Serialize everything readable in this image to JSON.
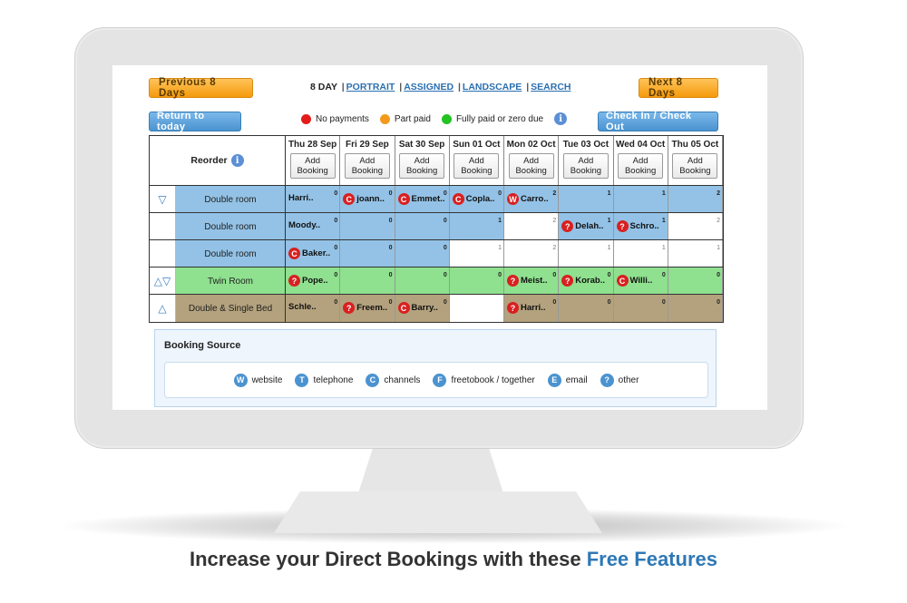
{
  "toolbar": {
    "prev_label": "Previous 8 Days",
    "next_label": "Next 8 Days",
    "return_label": "Return to today",
    "checkin_label": "Check In / Check Out",
    "view_current": "8 DAY",
    "views": [
      "PORTRAIT",
      "ASSIGNED",
      "LANDSCAPE",
      "SEARCH"
    ]
  },
  "legend": {
    "items": [
      {
        "label": "No payments",
        "color": "#e41b1b"
      },
      {
        "label": "Part paid",
        "color": "#f39a1c"
      },
      {
        "label": "Fully paid or zero due",
        "color": "#22c322"
      }
    ]
  },
  "grid": {
    "reorder_label": "Reorder",
    "add_booking_line1": "Add",
    "add_booking_line2": "Booking",
    "days": [
      "Thu 28 Sep",
      "Fri 29 Sep",
      "Sat 30 Sep",
      "Sun 01 Oct",
      "Mon 02 Oct",
      "Tue 03 Oct",
      "Wed 04 Oct",
      "Thu 05 Oct"
    ],
    "rows": [
      {
        "arrows": "▽",
        "name": "Double room",
        "bg": "#93c2e6",
        "cells": [
          {
            "guest": "Harri..",
            "src": "",
            "count": "0",
            "fill": "blue"
          },
          {
            "guest": "joann..",
            "src": "C",
            "count": "0",
            "fill": "blue"
          },
          {
            "guest": "Emmet..",
            "src": "C",
            "count": "0",
            "fill": "blue"
          },
          {
            "guest": "Copla..",
            "src": "C",
            "count": "0",
            "fill": "blue"
          },
          {
            "guest": "Carro..",
            "src": "W",
            "count": "2",
            "fill": "blue"
          },
          {
            "guest": "",
            "src": "",
            "count": "1",
            "fill": "blue"
          },
          {
            "guest": "",
            "src": "",
            "count": "1",
            "fill": "blue"
          },
          {
            "guest": "",
            "src": "",
            "count": "2",
            "fill": "blue"
          }
        ]
      },
      {
        "arrows": "",
        "name": "Double room",
        "bg": "#93c2e6",
        "cells": [
          {
            "guest": "Moody..",
            "src": "",
            "count": "0",
            "fill": "blue"
          },
          {
            "guest": "",
            "src": "",
            "count": "0",
            "fill": "blue"
          },
          {
            "guest": "",
            "src": "",
            "count": "0",
            "fill": "blue"
          },
          {
            "guest": "",
            "src": "",
            "count": "1",
            "fill": "blue"
          },
          {
            "guest": "",
            "src": "",
            "count": "2",
            "fill": "white"
          },
          {
            "guest": "Delah..",
            "src": "?",
            "count": "1",
            "fill": "blue"
          },
          {
            "guest": "Schro..",
            "src": "?",
            "count": "1",
            "fill": "blue"
          },
          {
            "guest": "",
            "src": "",
            "count": "2",
            "fill": "white"
          }
        ]
      },
      {
        "arrows": "",
        "name": "Double room",
        "bg": "#93c2e6",
        "cells": [
          {
            "guest": "Baker..",
            "src": "C",
            "count": "0",
            "fill": "blue"
          },
          {
            "guest": "",
            "src": "",
            "count": "0",
            "fill": "blue"
          },
          {
            "guest": "",
            "src": "",
            "count": "0",
            "fill": "blue"
          },
          {
            "guest": "",
            "src": "",
            "count": "1",
            "fill": "white"
          },
          {
            "guest": "",
            "src": "",
            "count": "2",
            "fill": "white"
          },
          {
            "guest": "",
            "src": "",
            "count": "1",
            "fill": "white"
          },
          {
            "guest": "",
            "src": "",
            "count": "1",
            "fill": "white"
          },
          {
            "guest": "",
            "src": "",
            "count": "1",
            "fill": "white"
          }
        ]
      },
      {
        "arrows": "△▽",
        "name": "Twin Room",
        "bg": "#8fe08f",
        "cells": [
          {
            "guest": "Pope..",
            "src": "?",
            "count": "0",
            "fill": "green"
          },
          {
            "guest": "",
            "src": "",
            "count": "0",
            "fill": "green"
          },
          {
            "guest": "",
            "src": "",
            "count": "0",
            "fill": "green"
          },
          {
            "guest": "",
            "src": "",
            "count": "0",
            "fill": "green"
          },
          {
            "guest": "Meist..",
            "src": "?",
            "count": "0",
            "fill": "green"
          },
          {
            "guest": "Korab..",
            "src": "?",
            "count": "0",
            "fill": "green"
          },
          {
            "guest": "Willi..",
            "src": "C",
            "count": "0",
            "fill": "green"
          },
          {
            "guest": "",
            "src": "",
            "count": "0",
            "fill": "green"
          }
        ]
      },
      {
        "arrows": "△",
        "name": "Double & Single Bed",
        "bg": "#b3a27d",
        "cells": [
          {
            "guest": "Schle..",
            "src": "",
            "count": "0",
            "fill": "tan"
          },
          {
            "guest": "Freem..",
            "src": "?",
            "count": "0",
            "fill": "tan"
          },
          {
            "guest": "Barry..",
            "src": "C",
            "count": "0",
            "fill": "tan"
          },
          {
            "guest": "",
            "src": "",
            "count": "",
            "fill": "white"
          },
          {
            "guest": "Harri..",
            "src": "?",
            "count": "0",
            "fill": "tan"
          },
          {
            "guest": "",
            "src": "",
            "count": "0",
            "fill": "tan"
          },
          {
            "guest": "",
            "src": "",
            "count": "0",
            "fill": "tan"
          },
          {
            "guest": "",
            "src": "",
            "count": "0",
            "fill": "tan"
          }
        ]
      }
    ]
  },
  "booking_source": {
    "title": "Booking Source",
    "items": [
      {
        "icon": "W",
        "label": "website"
      },
      {
        "icon": "T",
        "label": "telephone"
      },
      {
        "icon": "C",
        "label": "channels"
      },
      {
        "icon": "F",
        "label": "freetobook / together"
      },
      {
        "icon": "E",
        "label": "email"
      },
      {
        "icon": "?",
        "label": "other"
      }
    ]
  },
  "tagline": {
    "main": "Increase your Direct Bookings with these ",
    "highlight": "Free Features"
  },
  "colors": {
    "blue": "#93c2e6",
    "green": "#8fe08f",
    "tan": "#b3a27d",
    "white": "#ffffff",
    "accent": "#2f78b5"
  }
}
